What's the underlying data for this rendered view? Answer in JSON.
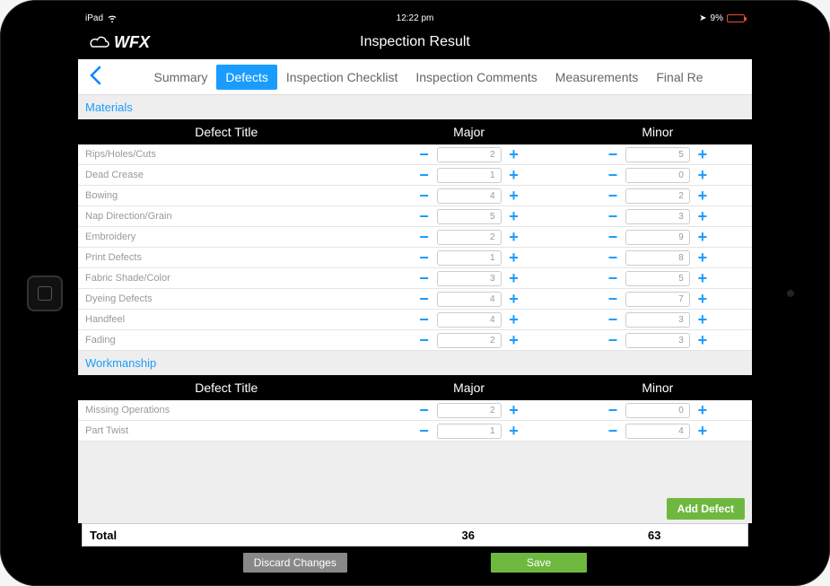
{
  "status": {
    "device": "iPad",
    "time": "12:22 pm",
    "battery_pct": "9%"
  },
  "header": {
    "brand": "WFX",
    "title": "Inspection Result"
  },
  "tabs": {
    "items": [
      "Summary",
      "Defects",
      "Inspection Checklist",
      "Inspection Comments",
      "Measurements",
      "Final Re"
    ],
    "active_index": 1
  },
  "sections": [
    {
      "label": "Materials",
      "columns": {
        "title": "Defect Title",
        "major": "Major",
        "minor": "Minor"
      },
      "rows": [
        {
          "title": "Rips/Holes/Cuts",
          "major": "2",
          "minor": "5"
        },
        {
          "title": "Dead Crease",
          "major": "1",
          "minor": "0"
        },
        {
          "title": "Bowing",
          "major": "4",
          "minor": "2"
        },
        {
          "title": "Nap Direction/Grain",
          "major": "5",
          "minor": "3"
        },
        {
          "title": "Embroidery",
          "major": "2",
          "minor": "9"
        },
        {
          "title": "Print Defects",
          "major": "1",
          "minor": "8"
        },
        {
          "title": "Fabric Shade/Color",
          "major": "3",
          "minor": "5"
        },
        {
          "title": "Dyeing Defects",
          "major": "4",
          "minor": "7"
        },
        {
          "title": "Handfeel",
          "major": "4",
          "minor": "3"
        },
        {
          "title": "Fading",
          "major": "2",
          "minor": "3"
        }
      ]
    },
    {
      "label": "Workmanship",
      "columns": {
        "title": "Defect Title",
        "major": "Major",
        "minor": "Minor"
      },
      "rows": [
        {
          "title": "Missing Operations",
          "major": "2",
          "minor": "0"
        },
        {
          "title": "Part Twist",
          "major": "1",
          "minor": "4"
        }
      ]
    }
  ],
  "actions": {
    "add_defect": "Add Defect",
    "discard": "Discard Changes",
    "save": "Save"
  },
  "totals": {
    "label": "Total",
    "major": "36",
    "minor": "63"
  }
}
